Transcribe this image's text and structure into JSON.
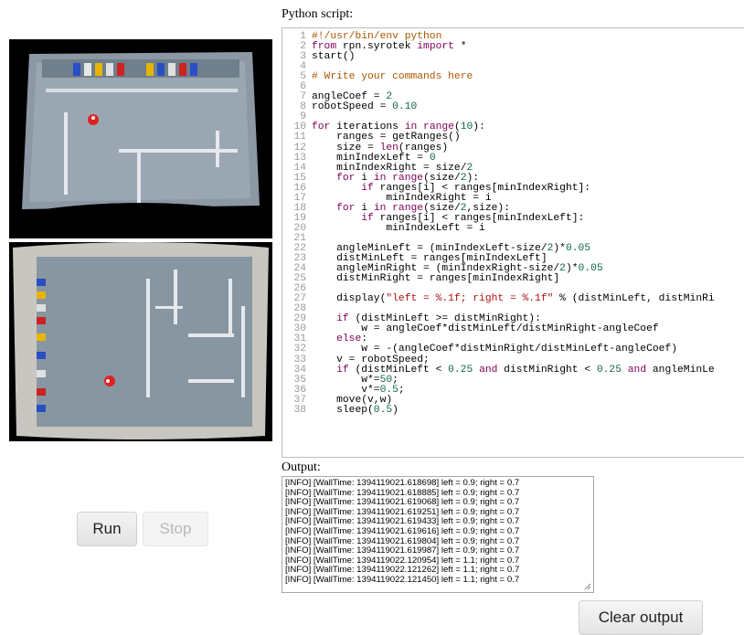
{
  "labels": {
    "script": "Python script:",
    "output": "Output:"
  },
  "buttons": {
    "run": "Run",
    "stop": "Stop",
    "clear": "Clear output"
  },
  "code_lines": [
    "#!/usr/bin/env python",
    "from rpn.syrotek import *",
    "start()",
    "",
    "# Write your commands here",
    "",
    "angleCoef = 2",
    "robotSpeed = 0.10",
    "",
    "for iterations in range(10):",
    "    ranges = getRanges()",
    "    size = len(ranges)",
    "    minIndexLeft = 0",
    "    minIndexRight = size/2",
    "    for i in range(size/2):",
    "        if ranges[i] < ranges[minIndexRight]:",
    "            minIndexRight = i",
    "    for i in range(size/2,size):",
    "        if ranges[i] < ranges[minIndexLeft]:",
    "            minIndexLeft = i",
    "",
    "    angleMinLeft = (minIndexLeft-size/2)*0.05",
    "    distMinLeft = ranges[minIndexLeft]",
    "    angleMinRight = (minIndexRight-size/2)*0.05",
    "    distMinRight = ranges[minIndexRight]",
    "",
    "    display(\"left = %.1f; right = %.1f\" % (distMinLeft, distMinRi",
    "",
    "    if (distMinLeft >= distMinRight):",
    "        w = angleCoef*distMinLeft/distMinRight-angleCoef",
    "    else:",
    "        w = -(angleCoef*distMinRight/distMinLeft-angleCoef)",
    "    v = robotSpeed;",
    "    if (distMinLeft < 0.25 and distMinRight < 0.25 and angleMinLe",
    "        w*=50;",
    "        v*=0.5;",
    "    move(v,w)",
    "    sleep(0.5)"
  ],
  "output_lines": [
    "[INFO] [WallTime: 1394119021.618698] left = 0.9; right = 0.7",
    "[INFO] [WallTime: 1394119021.618885] left = 0.9; right = 0.7",
    "[INFO] [WallTime: 1394119021.619068] left = 0.9; right = 0.7",
    "[INFO] [WallTime: 1394119021.619251] left = 0.9; right = 0.7",
    "[INFO] [WallTime: 1394119021.619433] left = 0.9; right = 0.7",
    "[INFO] [WallTime: 1394119021.619616] left = 0.9; right = 0.7",
    "[INFO] [WallTime: 1394119021.619804] left = 0.9; right = 0.7",
    "[INFO] [WallTime: 1394119021.619987] left = 0.9; right = 0.7",
    "[INFO] [WallTime: 1394119022.120954] left = 1.1; right = 0.7",
    "[INFO] [WallTime: 1394119022.121262] left = 1.1; right = 0.7",
    "[INFO] [WallTime: 1394119022.121450] left = 1.1; right = 0.7"
  ],
  "colors": {
    "keyword": "#7f0055",
    "number": "#116644",
    "string": "#aa1111",
    "comment": "#aa5500"
  }
}
